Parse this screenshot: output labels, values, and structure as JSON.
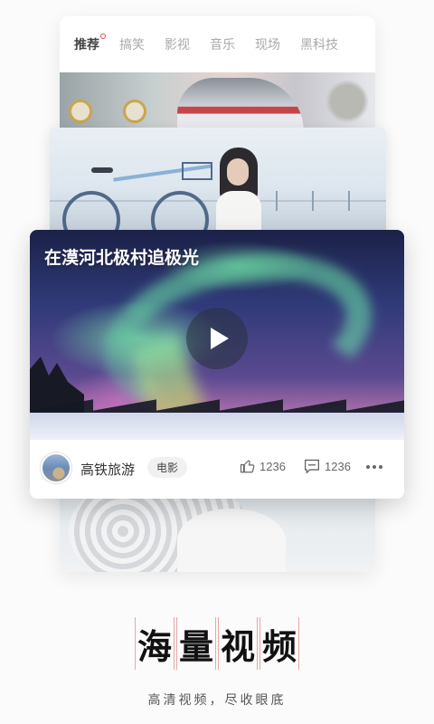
{
  "tabs": [
    {
      "label": "推荐",
      "active": true
    },
    {
      "label": "搞笑",
      "active": false
    },
    {
      "label": "影视",
      "active": false
    },
    {
      "label": "音乐",
      "active": false
    },
    {
      "label": "现场",
      "active": false
    },
    {
      "label": "黑科技",
      "active": false
    }
  ],
  "featured": {
    "title": "在漠河北极村追极光",
    "channel_name": "高铁旅游",
    "category_tag": "电影",
    "likes": "1236",
    "comments": "1236"
  },
  "slogan": {
    "chars": [
      "海",
      "量",
      "视",
      "频"
    ],
    "subtitle": "高清视频，尽收眼底"
  },
  "colors": {
    "accent_dot": "#e94a4a",
    "slogan_guides": "#e8a6a6"
  }
}
